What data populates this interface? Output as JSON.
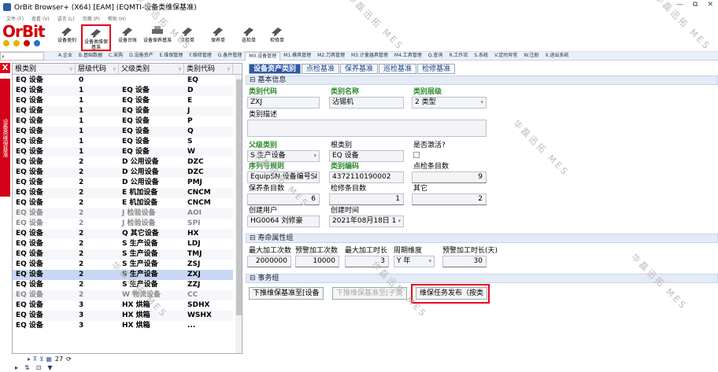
{
  "window": {
    "title": "OrBit Browser+ (X64) [EAM] (EQMTI-设备类维保基准)",
    "controls": [
      "—",
      "⧉",
      "✕"
    ]
  },
  "menubar": [
    "文件 (F)",
    "查看 (V)",
    "语言 (L)",
    "页面 (P)",
    "帮助 (H)"
  ],
  "logo": "OrBit",
  "toolbar": [
    {
      "label": "设备类别"
    },
    {
      "label": "设备类维保基准",
      "active": true
    },
    {
      "label": "设备台账"
    },
    {
      "label": "设备保养基准"
    },
    {
      "label": "点检单"
    },
    {
      "label": "保养单"
    },
    {
      "label": "巡检单"
    },
    {
      "label": "检修单"
    }
  ],
  "navtabs": [
    "A.企业",
    "B.基础数据",
    "C.采购",
    "D.设备资产",
    "E.维保管理",
    "F.维修管理",
    "G.备件管理",
    "M0.设备管理",
    "M1.模具管理",
    "M2.刀具管理",
    "M3.计量器具管理",
    "M4.工具管理",
    "Q.查询",
    "R.工作流",
    "S.系统",
    "V.定时异常",
    "W.注册",
    "X.退出系统"
  ],
  "navtab_active": 7,
  "leftside": {
    "close": "X",
    "vtab": "设备类维保基准"
  },
  "grid": {
    "columns": [
      "根类别",
      "层级代码",
      "父级类别",
      "类别代码"
    ],
    "rows": [
      [
        "EQ 设备",
        "0",
        "",
        "EQ"
      ],
      [
        "EQ 设备",
        "1",
        "EQ 设备",
        "D"
      ],
      [
        "EQ 设备",
        "1",
        "EQ 设备",
        "E"
      ],
      [
        "EQ 设备",
        "1",
        "EQ 设备",
        "J"
      ],
      [
        "EQ 设备",
        "1",
        "EQ 设备",
        "P"
      ],
      [
        "EQ 设备",
        "1",
        "EQ 设备",
        "Q"
      ],
      [
        "EQ 设备",
        "1",
        "EQ 设备",
        "S"
      ],
      [
        "EQ 设备",
        "1",
        "EQ 设备",
        "W"
      ],
      [
        "EQ 设备",
        "2",
        "D 公用设备",
        "DZC"
      ],
      [
        "EQ 设备",
        "2",
        "D 公用设备",
        "DZC"
      ],
      [
        "EQ 设备",
        "2",
        "D 公用设备",
        "PMJ"
      ],
      [
        "EQ 设备",
        "2",
        "E 机加设备",
        "CNCM"
      ],
      [
        "EQ 设备",
        "2",
        "E 机加设备",
        "CNCM"
      ],
      [
        "EQ 设备",
        "2",
        "J 检验设备",
        "AOI"
      ],
      [
        "EQ 设备",
        "2",
        "J 检验设备",
        "SPI"
      ],
      [
        "EQ 设备",
        "2",
        "Q 其它设备",
        "HX"
      ],
      [
        "EQ 设备",
        "2",
        "S 生产设备",
        "LDJ"
      ],
      [
        "EQ 设备",
        "2",
        "S 生产设备",
        "TMJ"
      ],
      [
        "EQ 设备",
        "2",
        "S 生产设备",
        "ZSJ"
      ],
      [
        "EQ 设备",
        "2",
        "S 生产设备",
        "ZXJ"
      ],
      [
        "EQ 设备",
        "2",
        "S 生产设备",
        "ZZJ"
      ],
      [
        "EQ 设备",
        "2",
        "W 物流设备",
        "CC"
      ],
      [
        "EQ 设备",
        "3",
        "HX 烘箱",
        "SDHX"
      ],
      [
        "EQ 设备",
        "3",
        "HX 烘箱",
        "WSHX"
      ],
      [
        "EQ 设备",
        "3",
        "HX 烘箱",
        "..."
      ]
    ],
    "selected_row": 19,
    "dim_rows": [
      13,
      14,
      21
    ],
    "footer_count": "27"
  },
  "subtabs": [
    "设备资产类别",
    "点检基准",
    "保养基准",
    "巡检基准",
    "检修基准"
  ],
  "sections": {
    "basic": "基本信息",
    "life": "寿命属性组",
    "tx": "事务组"
  },
  "basic": {
    "lbl_code": "类别代码",
    "code": "ZXJ",
    "lbl_name": "类别名称",
    "name": "沾锡机",
    "lbl_level": "类别层级",
    "level": "2 类型",
    "lbl_desc": "类别描述",
    "lbl_parent": "父级类别",
    "parent": "S 生产设备",
    "lbl_root": "根类别",
    "root": "EQ 设备",
    "lbl_active": "是否激活?",
    "lbl_seq": "序列号规则",
    "seq": "EquipSN 设备编号SI",
    "lbl_catno": "类别编码",
    "catno": "4372110190002",
    "lbl_check": "点检条目数",
    "check": "9",
    "lbl_maint": "保养条目数",
    "maint": "6",
    "lbl_repair": "检修条目数",
    "repair": "1",
    "lbl_other": "其它",
    "other": "2",
    "lbl_user": "创建用户",
    "user": "HG0064 刘修豪",
    "lbl_time": "创建时间",
    "time": "2021年08月18日 1"
  },
  "life": {
    "lbl_max": "最大加工次数",
    "max": "2000000",
    "lbl_pre": "预警加工次数",
    "pre": "10000",
    "lbl_maxlen": "最大加工时长",
    "maxlen": "3",
    "lbl_period": "周期维度",
    "period": "Y 年",
    "lbl_prelen": "预警加工时长(天)",
    "prelen": "30"
  },
  "tx": {
    "btn1": "下推维保基准至[设备",
    "btn2": "下推维保基准至[子类",
    "btn3": "维保任务发布（按类"
  },
  "watermark": "华磊迅拓 MES"
}
